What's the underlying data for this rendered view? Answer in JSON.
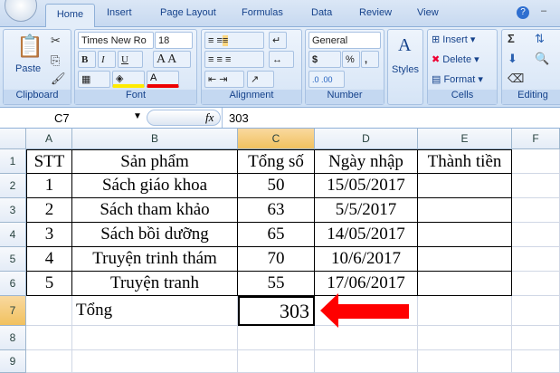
{
  "tabs": [
    "Home",
    "Insert",
    "Page Layout",
    "Formulas",
    "Data",
    "Review",
    "View"
  ],
  "ribbon": {
    "clipboard": {
      "paste": "Paste",
      "label": "Clipboard"
    },
    "font": {
      "name": "Times New Ro",
      "size": "18",
      "bold": "B",
      "italic": "I",
      "underline": "U",
      "label": "Font"
    },
    "alignment": {
      "label": "Alignment"
    },
    "number": {
      "format": "General",
      "currency": "$",
      "percent": "%",
      "comma": ",",
      "label": "Number"
    },
    "styles": {
      "label": "Styles"
    },
    "cells": {
      "insert": "Insert",
      "delete": "Delete",
      "format": "Format",
      "label": "Cells"
    },
    "editing": {
      "sum": "Σ",
      "label": "Editing"
    }
  },
  "formula_bar": {
    "name_box": "C7",
    "fx": "fx",
    "value": "303"
  },
  "columns": [
    "A",
    "B",
    "C",
    "D",
    "E",
    "F"
  ],
  "rows": [
    "1",
    "2",
    "3",
    "4",
    "5",
    "6",
    "7",
    "8",
    "9"
  ],
  "table": {
    "headers": [
      "STT",
      "Sản phẩm",
      "Tổng số",
      "Ngày nhập",
      "Thành tiền"
    ],
    "data": [
      [
        "1",
        "Sách giáo khoa",
        "50",
        "15/05/2017",
        ""
      ],
      [
        "2",
        "Sách tham khảo",
        "63",
        "5/5/2017",
        ""
      ],
      [
        "3",
        "Sách bồi dưỡng",
        "65",
        "14/05/2017",
        ""
      ],
      [
        "4",
        "Truyện trinh thám",
        "70",
        "10/6/2017",
        ""
      ],
      [
        "5",
        "Truyện tranh",
        "55",
        "17/06/2017",
        ""
      ]
    ],
    "total_label": "Tổng",
    "total_value": "303"
  },
  "colors": {
    "arrow": "#ff0000",
    "selected_header": "#f1c15f"
  }
}
